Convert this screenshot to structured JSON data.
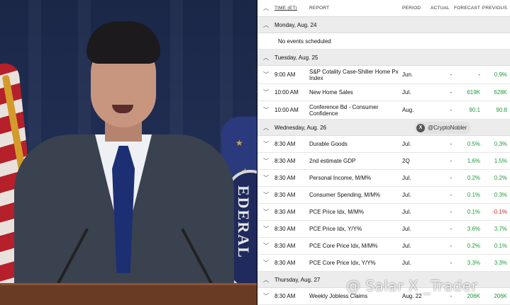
{
  "header": {
    "time": "TIME (ET)",
    "report": "REPORT",
    "period": "PERIOD",
    "actual": "ACTUAL",
    "forecast": "FORECAST",
    "previous": "PREVIOUS"
  },
  "days": [
    {
      "label": "Monday, Aug. 24",
      "empty": "No events scheduled",
      "events": []
    },
    {
      "label": "Tuesday, Aug. 25",
      "events": [
        {
          "time": "9:00 AM",
          "report": "S&P Cotality Case-Shiller Home Px Index",
          "period": "Jun.",
          "actual": "-",
          "forecast": "-",
          "previous": "0.9%"
        },
        {
          "time": "10:00 AM",
          "report": "New Home Sales",
          "period": "Jul.",
          "actual": "-",
          "forecast": "619K",
          "previous": "628K"
        },
        {
          "time": "10:00 AM",
          "report": "Conference Bd - Consumer Confidence",
          "period": "Aug.",
          "actual": "-",
          "forecast": "90.1",
          "previous": "90.8"
        }
      ]
    },
    {
      "label": "Wednesday, Aug. 26",
      "events": []
    },
    {
      "label": "",
      "events": [
        {
          "time": "8:30 AM",
          "report": "Durable Goods",
          "period": "Jul.",
          "actual": "-",
          "forecast": "0.5%",
          "previous": "0.3%"
        },
        {
          "time": "8:30 AM",
          "report": "2nd estimate GDP",
          "period": "2Q",
          "actual": "-",
          "forecast": "1.6%",
          "previous": "1.5%"
        },
        {
          "time": "8:30 AM",
          "report": "Personal Income, M/M%",
          "period": "Jul.",
          "actual": "-",
          "forecast": "0.2%",
          "previous": "0.2%"
        },
        {
          "time": "8:30 AM",
          "report": "Consumer Spending, M/M%",
          "period": "Jul.",
          "actual": "-",
          "forecast": "0.1%",
          "previous": "0.3%"
        },
        {
          "time": "8:30 AM",
          "report": "PCE Price Idx, M/M%",
          "period": "Jul.",
          "actual": "-",
          "forecast": "0.1%",
          "previous": "-0.1%"
        },
        {
          "time": "8:30 AM",
          "report": "PCE Price Idx, Y/Y%",
          "period": "Jul.",
          "actual": "-",
          "forecast": "3.6%",
          "previous": "3.7%"
        },
        {
          "time": "8:30 AM",
          "report": "PCE Core Price Idx, M/M%",
          "period": "Jul.",
          "actual": "-",
          "forecast": "0.2%",
          "previous": "0.1%"
        },
        {
          "time": "8:30 AM",
          "report": "PCE Core Price Idx, Y/Y%",
          "period": "Jul.",
          "actual": "-",
          "forecast": "3.3%",
          "previous": "3.3%"
        }
      ]
    },
    {
      "label": "Thursday, Aug. 27",
      "events": [
        {
          "time": "8:30 AM",
          "report": "Weekly Jobless Claims",
          "period": "Aug. 22",
          "actual": "-",
          "forecast": "206K",
          "previous": "206K"
        }
      ]
    }
  ],
  "colors": {
    "positive": "#1f9a3a",
    "negative": "#d2202a",
    "day_bg": "#ececec"
  },
  "badge": {
    "icon": "x-logo-icon",
    "handle": "@CryptoNobler"
  },
  "watermark": {
    "text": "@ Salar X _Trader"
  },
  "video": {
    "seal_text": "EDERAL"
  }
}
